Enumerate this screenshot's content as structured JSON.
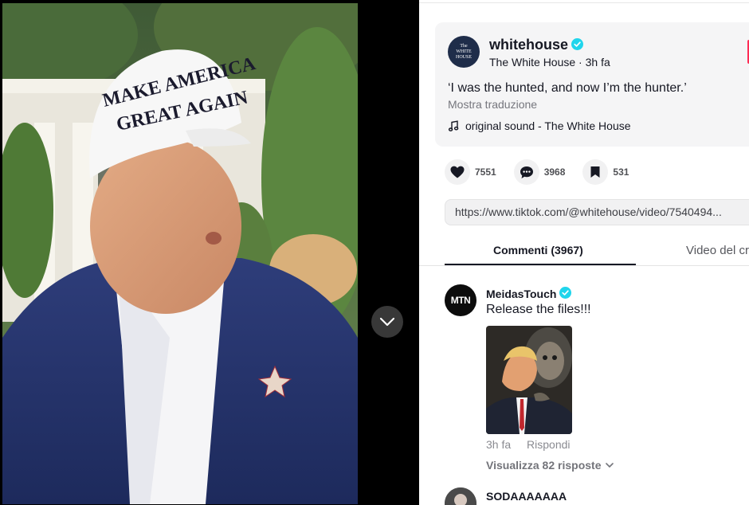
{
  "post": {
    "author": "whitehouse",
    "avatar_text": [
      "The",
      "WHITE",
      "HOUSE"
    ],
    "display_name": "The White House",
    "separator": " · ",
    "time": "3h fa",
    "caption": "‘I was the hunted, and now I’m the hunter.’",
    "translate_label": "Mostra traduzione",
    "music": "original sound - The White House",
    "icons": {
      "verified": "verified-badge-icon",
      "music": "music-note-icon"
    }
  },
  "actions": {
    "likes": "7551",
    "comments": "3968",
    "saves": "531",
    "icons": [
      "heart-icon",
      "comment-bubble-icon",
      "bookmark-icon"
    ]
  },
  "link": "https://www.tiktok.com/@whitehouse/video/7540494...",
  "tabs": {
    "comments": "Commenti (3967)",
    "creator_videos": "Video del cr"
  },
  "comments": [
    {
      "avatar_text": "MTN",
      "user": "MeidasTouch",
      "verified": true,
      "text": "Release the files!!!",
      "has_image": true,
      "time": "3h fa",
      "reply_label": "Rispondi",
      "view_replies": "Visualizza 82 risposte"
    },
    {
      "user": "SODAAAAAAA"
    }
  ],
  "colors": {
    "accent": "#fe2c55",
    "verified": "#20d5ec",
    "text": "#161823",
    "muted": "#75767d",
    "card_bg": "#f5f5f6"
  }
}
